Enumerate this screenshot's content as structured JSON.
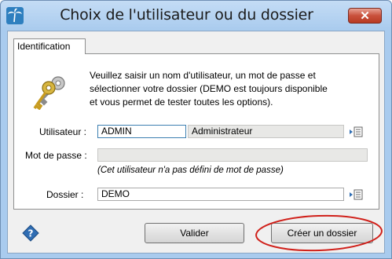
{
  "window": {
    "title": "Choix de l'utilisateur ou du dossier",
    "close_label": "✕"
  },
  "tabs": [
    {
      "label": "Identification"
    }
  ],
  "intro": {
    "line1": "Veuillez saisir un nom d'utilisateur, un mot de passe et",
    "line2": "sélectionner votre dossier (DEMO est toujours disponible",
    "line3": "et vous permet de tester toutes les options)."
  },
  "form": {
    "user_label": "Utilisateur :",
    "user_value": "ADMIN",
    "user_fullname": "Administrateur",
    "password_label": "Mot de passe :",
    "password_value": "",
    "password_note": "(Cet utilisateur n'a pas défini de mot de passe)",
    "folder_label": "Dossier :",
    "folder_value": "DEMO"
  },
  "buttons": {
    "validate_label": "Valider",
    "create_folder_label": "Créer un dossier"
  },
  "icons": {
    "app": "palm-tree-icon",
    "keys": "keys-icon",
    "picker": "list-picker-icon",
    "help": "help-icon"
  },
  "colors": {
    "frame": "#a9cbee",
    "close_button": "#c9513c",
    "highlight_circle": "#d0201a",
    "help_icon": "#2f6db3"
  }
}
